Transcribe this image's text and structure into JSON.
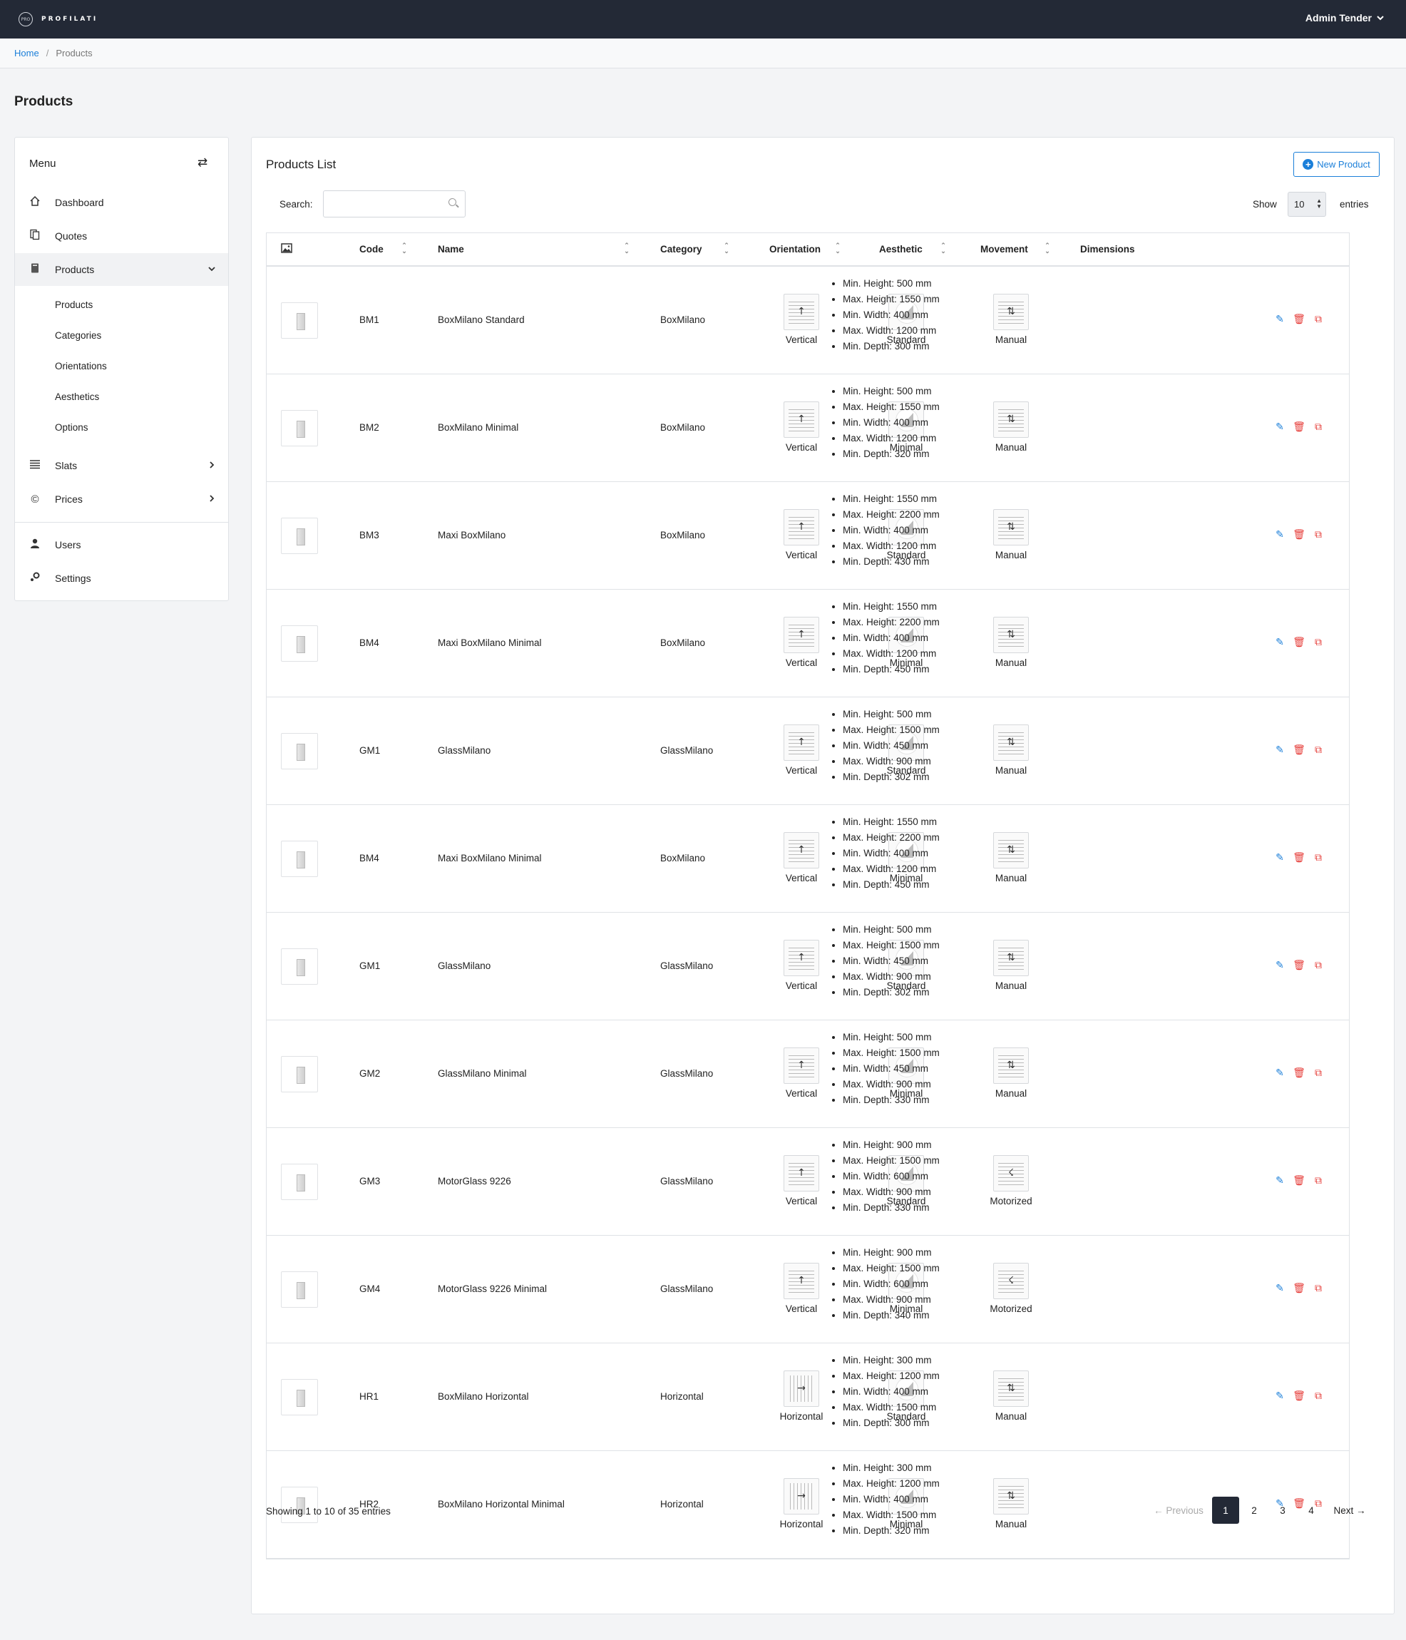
{
  "app": {
    "brand_mark": "PRO",
    "brand_name": "PROFILATI",
    "user_name": "Admin Tender"
  },
  "breadcrumb": {
    "home": "Home",
    "current": "Products"
  },
  "page_title": "Products",
  "sidebar": {
    "heading": "Menu",
    "items": [
      {
        "label": "Dashboard",
        "icon": "home-icon"
      },
      {
        "label": "Quotes",
        "icon": "documents-icon"
      },
      {
        "label": "Products",
        "icon": "book-icon"
      },
      {
        "label": "Slats",
        "icon": "list-icon"
      },
      {
        "label": "Prices",
        "icon": "copyright-icon"
      },
      {
        "label": "Users",
        "icon": "user-icon"
      },
      {
        "label": "Settings",
        "icon": "gear-icon"
      }
    ],
    "products_sub": [
      "Products",
      "Categories",
      "Orientations",
      "Aesthetics",
      "Options"
    ]
  },
  "main": {
    "title": "Products List",
    "new_button": "New Product",
    "search_label": "Search:",
    "search_value": "",
    "show_label": "Show",
    "entries_value": "10",
    "entries_label": "entries",
    "columns": [
      "Code",
      "Name",
      "Category",
      "Orientation",
      "Aesthetic",
      "Movement",
      "Dimensions"
    ]
  },
  "rows": [
    {
      "code": "BM1",
      "name": "BoxMilano Standard",
      "category": "BoxMilano",
      "orientation": "Vertical",
      "aesthetic": "Standard",
      "movement": "Manual",
      "dims": [
        "Min. Height: 500 mm",
        "Max. Height: 1550 mm",
        "Min. Width: 400 mm",
        "Max. Width: 1200 mm",
        "Min. Depth: 300 mm"
      ]
    },
    {
      "code": "BM2",
      "name": "BoxMilano Minimal",
      "category": "BoxMilano",
      "orientation": "Vertical",
      "aesthetic": "Minimal",
      "movement": "Manual",
      "dims": [
        "Min. Height: 500 mm",
        "Max. Height: 1550 mm",
        "Min. Width: 400 mm",
        "Max. Width: 1200 mm",
        "Min. Depth: 320 mm"
      ]
    },
    {
      "code": "BM3",
      "name": "Maxi BoxMilano",
      "category": "BoxMilano",
      "orientation": "Vertical",
      "aesthetic": "Standard",
      "movement": "Manual",
      "dims": [
        "Min. Height: 1550 mm",
        "Max. Height: 2200 mm",
        "Min. Width: 400 mm",
        "Max. Width: 1200 mm",
        "Min. Depth: 430 mm"
      ]
    },
    {
      "code": "BM4",
      "name": "Maxi BoxMilano Minimal",
      "category": "BoxMilano",
      "orientation": "Vertical",
      "aesthetic": "Minimal",
      "movement": "Manual",
      "dims": [
        "Min. Height: 1550 mm",
        "Max. Height: 2200 mm",
        "Min. Width: 400 mm",
        "Max. Width: 1200 mm",
        "Min. Depth: 450 mm"
      ]
    },
    {
      "code": "GM1",
      "name": "GlassMilano",
      "category": "GlassMilano",
      "orientation": "Vertical",
      "aesthetic": "Standard",
      "movement": "Manual",
      "dims": [
        "Min. Height: 500 mm",
        "Max. Height: 1500 mm",
        "Min. Width: 450 mm",
        "Max. Width: 900 mm",
        "Min. Depth: 302 mm"
      ]
    },
    {
      "code": "BM4",
      "name": "Maxi BoxMilano Minimal",
      "category": "BoxMilano",
      "orientation": "Vertical",
      "aesthetic": "Minimal",
      "movement": "Manual",
      "dims": [
        "Min. Height: 1550 mm",
        "Max. Height: 2200 mm",
        "Min. Width: 400 mm",
        "Max. Width: 1200 mm",
        "Min. Depth: 450 mm"
      ]
    },
    {
      "code": "GM1",
      "name": "GlassMilano",
      "category": "GlassMilano",
      "orientation": "Vertical",
      "aesthetic": "Standard",
      "movement": "Manual",
      "dims": [
        "Min. Height: 500 mm",
        "Max. Height: 1500 mm",
        "Min. Width: 450 mm",
        "Max. Width: 900 mm",
        "Min. Depth: 302 mm"
      ]
    },
    {
      "code": "GM2",
      "name": "GlassMilano Minimal",
      "category": "GlassMilano",
      "orientation": "Vertical",
      "aesthetic": "Minimal",
      "movement": "Manual",
      "dims": [
        "Min. Height: 500 mm",
        "Max. Height: 1500 mm",
        "Min. Width: 450 mm",
        "Max. Width: 900 mm",
        "Min. Depth: 330 mm"
      ]
    },
    {
      "code": "GM3",
      "name": "MotorGlass 9226",
      "category": "GlassMilano",
      "orientation": "Vertical",
      "aesthetic": "Standard",
      "movement": "Motorized",
      "dims": [
        "Min. Height: 900 mm",
        "Max. Height: 1500 mm",
        "Min. Width: 600 mm",
        "Max. Width: 900 mm",
        "Min. Depth: 330 mm"
      ]
    },
    {
      "code": "GM4",
      "name": "MotorGlass 9226 Minimal",
      "category": "GlassMilano",
      "orientation": "Vertical",
      "aesthetic": "Minimal",
      "movement": "Motorized",
      "dims": [
        "Min. Height: 900 mm",
        "Max. Height: 1500 mm",
        "Min. Width: 600 mm",
        "Max. Width: 900 mm",
        "Min. Depth: 340 mm"
      ]
    },
    {
      "code": "HR1",
      "name": "BoxMilano Horizontal",
      "category": "Horizontal",
      "orientation": "Horizontal",
      "aesthetic": "Standard",
      "movement": "Manual",
      "dims": [
        "Min. Height: 300 mm",
        "Max. Height: 1200 mm",
        "Min. Width: 400 mm",
        "Max. Width: 1500 mm",
        "Min. Depth: 300 mm"
      ]
    },
    {
      "code": "HR2",
      "name": "BoxMilano Horizontal Minimal",
      "category": "Horizontal",
      "orientation": "Horizontal",
      "aesthetic": "Minimal",
      "movement": "Manual",
      "dims": [
        "Min. Height: 300 mm",
        "Max. Height: 1200 mm",
        "Min. Width: 400 mm",
        "Max. Width: 1500 mm",
        "Min. Depth: 320 mm"
      ]
    }
  ],
  "footer": {
    "info": "Showing 1 to 10 of 35 entries",
    "previous": "← Previous",
    "pages": [
      "1",
      "2",
      "3",
      "4"
    ],
    "current_page": "1",
    "next": "Next →"
  },
  "colors": {
    "topbar": "#232936",
    "accent": "#1b7fd9",
    "danger": "#e53935",
    "current_page": "#232936"
  }
}
